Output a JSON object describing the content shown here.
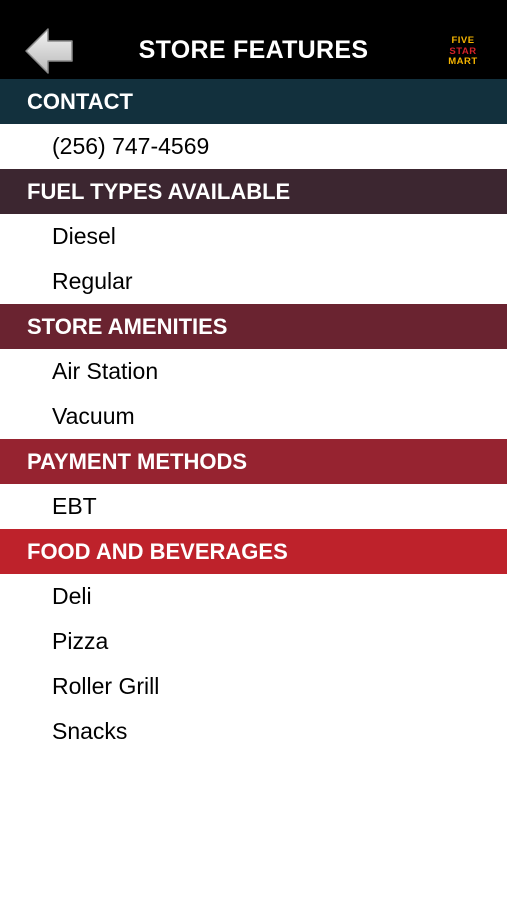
{
  "header": {
    "title": "STORE FEATURES",
    "back_icon": "back-arrow-icon",
    "logo": {
      "line1": "FIVE",
      "line2": "STAR",
      "line3": "MART",
      "colors": [
        "#f5b400",
        "#d22128",
        "#f5b400"
      ]
    }
  },
  "sections": {
    "contact": {
      "title": "CONTACT",
      "color": "#12303d",
      "items": [
        "(256) 747-4569"
      ]
    },
    "fuel_types": {
      "title": "FUEL TYPES AVAILABLE",
      "color": "#3c2630",
      "items": [
        "Diesel",
        "Regular"
      ]
    },
    "store_amenities": {
      "title": "STORE AMENITIES",
      "color": "#6a2330",
      "items": [
        "Air Station",
        "Vacuum"
      ]
    },
    "payment_methods": {
      "title": "PAYMENT METHODS",
      "color": "#962330",
      "items": [
        "EBT"
      ]
    },
    "food_beverages": {
      "title": "FOOD AND BEVERAGES",
      "color": "#be222b",
      "items": [
        "Deli",
        "Pizza",
        "Roller Grill",
        "Snacks"
      ]
    }
  }
}
